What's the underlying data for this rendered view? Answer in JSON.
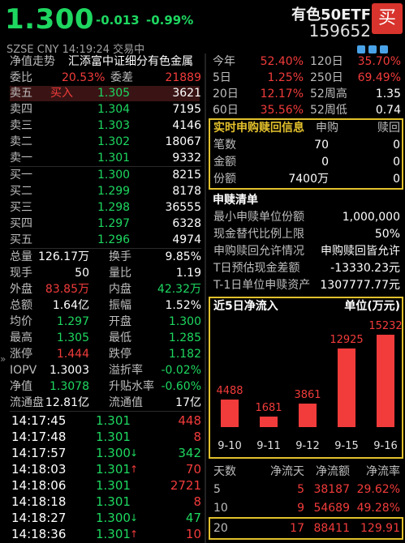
{
  "header": {
    "price": "1.300",
    "change": "-0.013",
    "change_pct": "-0.99%",
    "fund_name": "有色50ETF",
    "fund_code": "159652",
    "buy_label": "买",
    "sub_info": "SZSE  CNY  14:19:24  交易中"
  },
  "index_row": {
    "label": "净值走势",
    "value": "汇添富中证细分有色金属"
  },
  "weibi": {
    "label1": "委比",
    "value1": "20.53%",
    "label2": "委差",
    "value2": "21889"
  },
  "asks": [
    {
      "label": "卖五",
      "tag": "买入",
      "price": "1.305",
      "vol": "3621"
    },
    {
      "label": "卖四",
      "price": "1.304",
      "vol": "7195"
    },
    {
      "label": "卖三",
      "price": "1.303",
      "vol": "4146"
    },
    {
      "label": "卖二",
      "price": "1.302",
      "vol": "18067"
    },
    {
      "label": "卖一",
      "price": "1.301",
      "vol": "9332"
    }
  ],
  "bids": [
    {
      "label": "买一",
      "price": "1.300",
      "vol": "8215"
    },
    {
      "label": "买二",
      "price": "1.299",
      "vol": "8178"
    },
    {
      "label": "买三",
      "price": "1.298",
      "vol": "36555"
    },
    {
      "label": "买四",
      "price": "1.297",
      "vol": "6328"
    },
    {
      "label": "买五",
      "price": "1.296",
      "vol": "4974"
    }
  ],
  "stats": [
    {
      "l1": "总量",
      "v1": "126.17万",
      "c1": "white",
      "l2": "换手",
      "v2": "9.85%",
      "c2": "white"
    },
    {
      "l1": "现手",
      "v1": "50",
      "c1": "white",
      "l2": "量比",
      "v2": "1.19",
      "c2": "white"
    },
    {
      "l1": "外盘",
      "v1": "83.85万",
      "c1": "red",
      "l2": "内盘",
      "v2": "42.32万",
      "c2": "green"
    },
    {
      "l1": "总额",
      "v1": "1.64亿",
      "c1": "white",
      "l2": "振幅",
      "v2": "1.52%",
      "c2": "white"
    },
    {
      "l1": "均价",
      "v1": "1.297",
      "c1": "green",
      "l2": "开盘",
      "v2": "1.300",
      "c2": "green"
    },
    {
      "l1": "最高",
      "v1": "1.305",
      "c1": "green",
      "l2": "最低",
      "v2": "1.285",
      "c2": "green"
    },
    {
      "l1": "涨停",
      "v1": "1.444",
      "c1": "red",
      "l2": "跌停",
      "v2": "1.182",
      "c2": "green"
    },
    {
      "l1": "IOPV",
      "v1": "1.3003",
      "c1": "white",
      "l2": "溢折率",
      "v2": "-0.02%",
      "c2": "green"
    },
    {
      "l1": "净值",
      "v1": "1.3078",
      "c1": "green",
      "l2": "升贴水率",
      "v2": "-0.60%",
      "c2": "green"
    },
    {
      "l1": "流通盘",
      "v1": "12.81亿",
      "c1": "white",
      "l2": "流通值",
      "v2": "17亿",
      "c2": "white"
    }
  ],
  "ticks": [
    {
      "time": "14:17:45",
      "price": "1.301",
      "arrow": "",
      "vol": "448",
      "vc": "red"
    },
    {
      "time": "14:17:48",
      "price": "1.301",
      "arrow": "",
      "vol": "8",
      "vc": "red"
    },
    {
      "time": "14:17:57",
      "price": "1.300",
      "arrow": "↓",
      "vol": "342",
      "vc": "green"
    },
    {
      "time": "14:18:03",
      "price": "1.301",
      "arrow": "↑",
      "vol": "70",
      "vc": "red"
    },
    {
      "time": "14:18:06",
      "price": "1.301",
      "arrow": "",
      "vol": "2721",
      "vc": "red"
    },
    {
      "time": "14:18:18",
      "price": "1.301",
      "arrow": "",
      "vol": "8",
      "vc": "red"
    },
    {
      "time": "14:18:27",
      "price": "1.300",
      "arrow": "↓",
      "vol": "47",
      "vc": "green"
    },
    {
      "time": "14:18:36",
      "price": "1.301",
      "arrow": "↑",
      "vol": "10",
      "vc": "red"
    }
  ],
  "performance": [
    {
      "l1": "今年",
      "v1": "52.40%",
      "l2": "120日",
      "v2": "35.70%"
    },
    {
      "l1": "5日",
      "v1": "1.25%",
      "l2": "250日",
      "v2": "69.49%"
    },
    {
      "l1": "20日",
      "v1": "12.17%",
      "l2": "52周高",
      "v2": "1.35"
    },
    {
      "l1": "60日",
      "v1": "35.56%",
      "l2": "52周低",
      "v2": "0.74"
    }
  ],
  "realtime": {
    "title": "实时申购赎回信息",
    "col1": "申购",
    "col2": "赎回",
    "rows": [
      {
        "label": "笔数",
        "v1": "70",
        "v2": "0"
      },
      {
        "label": "金额",
        "v1": "0",
        "v2": "0"
      },
      {
        "label": "份额",
        "v1": "7400万",
        "v2": "0"
      }
    ]
  },
  "redemption": {
    "title": "申赎清单",
    "rows": [
      {
        "label": "最小申赎单位份额",
        "value": "1,000,000"
      },
      {
        "label": "现金替代比例上限",
        "value": "50%"
      },
      {
        "label": "申购赎回允许情况",
        "value": "申购赎回皆允许"
      },
      {
        "label": "T日预估现金差额",
        "value": "-13330.23元"
      },
      {
        "label": "T-1日单位申赎资产",
        "value": "1307777.77元"
      }
    ]
  },
  "flow_chart": {
    "title": "近5日净流入",
    "unit": "单位(万元)"
  },
  "chart_data": {
    "type": "bar",
    "title": "近5日净流入",
    "ylabel": "单位(万元)",
    "categories": [
      "9-10",
      "9-11",
      "9-12",
      "9-15",
      "9-16"
    ],
    "values": [
      4488,
      1681,
      3861,
      12925,
      15232
    ],
    "ylim": [
      0,
      16000
    ],
    "color": "#f23b3b"
  },
  "flow_table": {
    "headers": [
      "天数",
      "净流天",
      "净流额",
      "净流率"
    ],
    "rows": [
      {
        "days": "5",
        "flow_days": "5",
        "amount": "38187",
        "rate": "29.62%"
      },
      {
        "days": "10",
        "flow_days": "9",
        "amount": "54689",
        "rate": "49.28%"
      },
      {
        "days": "20",
        "flow_days": "17",
        "amount": "88411",
        "rate": "129.91"
      }
    ]
  },
  "colors": {
    "up": "#f23b3b",
    "down": "#1ed760",
    "highlight": "#e3c12c",
    "buy_button": "#d8332d"
  }
}
